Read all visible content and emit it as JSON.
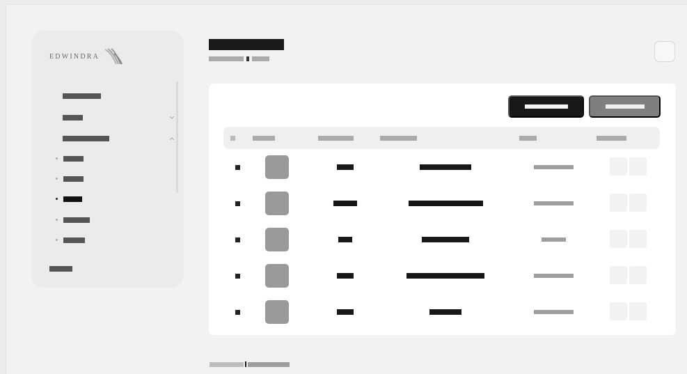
{
  "sidebar": {
    "brand": "EDWINDRA",
    "brand_icon": "wheat-leaf-icon",
    "items": [
      {
        "label": "████████████",
        "type": "top"
      },
      {
        "label": "███████",
        "type": "expandable",
        "chevron": "chevron-down-icon"
      },
      {
        "label": "████████████████",
        "type": "expanded",
        "chevron": "chevron-up-icon"
      },
      {
        "label": "███████",
        "type": "child"
      },
      {
        "label": "███████",
        "type": "child"
      },
      {
        "label": "██████",
        "type": "child",
        "active": true
      },
      {
        "label": "█████████",
        "type": "child"
      },
      {
        "label": "████████",
        "type": "child"
      },
      {
        "label": "████████",
        "type": "footer"
      }
    ]
  },
  "header": {
    "title": "████████████",
    "breadcrumb": [
      "██████████",
      "██████"
    ],
    "top_action_icon": "square-outline-icon"
  },
  "toolbar": {
    "primary_label": "████████████",
    "secondary_label": "██████████"
  },
  "table": {
    "columns": [
      "■",
      "██████",
      "██████████",
      "██████████",
      "████",
      "█████████"
    ],
    "rows": [
      {
        "marker": "■",
        "thumb": "image-thumb",
        "col_a": "█████",
        "col_b": "██████████████",
        "col_c": "████████████"
      },
      {
        "marker": "■",
        "thumb": "image-thumb",
        "col_a": "███████",
        "col_b": "█████████████████",
        "col_c": "████████████"
      },
      {
        "marker": "■",
        "thumb": "image-thumb",
        "col_a": "████",
        "col_b": "█████████████",
        "col_c": "████████"
      },
      {
        "marker": "■",
        "thumb": "image-thumb",
        "col_a": "████",
        "col_b": "██████████████████",
        "col_c": "████████████"
      },
      {
        "marker": "■",
        "thumb": "image-thumb",
        "col_a": "████",
        "col_b": "█████████",
        "col_c": "████████████"
      }
    ]
  },
  "pagination": {
    "left": "████████",
    "right": "██████████"
  },
  "colors": {
    "background": "#f2f2f2",
    "sidebar": "#ebebeb",
    "panel": "#ffffff",
    "primary": "#181818",
    "secondary": "#7f7f7f",
    "thumb": "#999999"
  }
}
